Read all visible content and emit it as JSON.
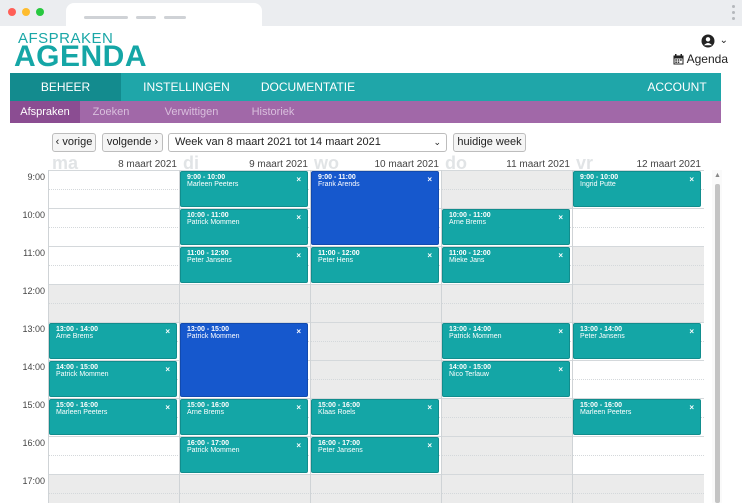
{
  "browser": {
    "title": ""
  },
  "logo": {
    "top": "AFSPRAKEN",
    "main": "AGENDA"
  },
  "user": {
    "icon": "user-icon",
    "agenda_label": "Agenda"
  },
  "nav": [
    {
      "label": "BEHEER",
      "active": true
    },
    {
      "label": "INSTELLINGEN",
      "active": false
    },
    {
      "label": "DOCUMENTATIE",
      "active": false
    },
    {
      "label": "ACCOUNT",
      "active": false
    }
  ],
  "subnav": [
    {
      "label": "Afspraken",
      "active": true
    },
    {
      "label": "Zoeken",
      "active": false
    },
    {
      "label": "Verwittigen",
      "active": false
    },
    {
      "label": "Historiek",
      "active": false
    }
  ],
  "toolbar": {
    "prev": "‹ vorige",
    "next": "volgende ›",
    "week_select": "Week van 8 maart 2021 tot 14 maart 2021",
    "today": "huidige week"
  },
  "days": [
    {
      "abbr": "ma",
      "date": "8 maart 2021"
    },
    {
      "abbr": "di",
      "date": "9 maart 2021"
    },
    {
      "abbr": "wo",
      "date": "10 maart 2021"
    },
    {
      "abbr": "do",
      "date": "11 maart 2021"
    },
    {
      "abbr": "vr",
      "date": "12 maart 2021"
    }
  ],
  "hours": [
    "9:00",
    "10:00",
    "11:00",
    "12:00",
    "13:00",
    "14:00",
    "15:00",
    "16:00",
    "17:00"
  ],
  "events": [
    {
      "day": 0,
      "start": 13,
      "end": 14,
      "time": "13:00 - 14:00",
      "name": "Arne Brems",
      "color": "teal"
    },
    {
      "day": 0,
      "start": 14,
      "end": 15,
      "time": "14:00 - 15:00",
      "name": "Patrick Mommen",
      "color": "teal"
    },
    {
      "day": 0,
      "start": 15,
      "end": 16,
      "time": "15:00 - 16:00",
      "name": "Marleen Peeters",
      "color": "teal"
    },
    {
      "day": 1,
      "start": 9,
      "end": 10,
      "time": "9:00 - 10:00",
      "name": "Marleen Peeters",
      "color": "teal"
    },
    {
      "day": 1,
      "start": 10,
      "end": 11,
      "time": "10:00 - 11:00",
      "name": "Patrick Mommen",
      "color": "teal"
    },
    {
      "day": 1,
      "start": 11,
      "end": 12,
      "time": "11:00 - 12:00",
      "name": "Peter Jansens",
      "color": "teal"
    },
    {
      "day": 1,
      "start": 13,
      "end": 15,
      "time": "13:00 - 15:00",
      "name": "Patrick Mommen",
      "color": "blue"
    },
    {
      "day": 1,
      "start": 15,
      "end": 16,
      "time": "15:00 - 16:00",
      "name": "Arne Brems",
      "color": "teal"
    },
    {
      "day": 1,
      "start": 16,
      "end": 17,
      "time": "16:00 - 17:00",
      "name": "Patrick Mommen",
      "color": "teal"
    },
    {
      "day": 2,
      "start": 9,
      "end": 11,
      "time": "9:00 - 11:00",
      "name": "Frank Arends",
      "color": "blue"
    },
    {
      "day": 2,
      "start": 11,
      "end": 12,
      "time": "11:00 - 12:00",
      "name": "Peter Hens",
      "color": "teal"
    },
    {
      "day": 2,
      "start": 15,
      "end": 16,
      "time": "15:00 - 16:00",
      "name": "Klaas Roels",
      "color": "teal"
    },
    {
      "day": 2,
      "start": 16,
      "end": 17,
      "time": "16:00 - 17:00",
      "name": "Peter Jansens",
      "color": "teal"
    },
    {
      "day": 3,
      "start": 10,
      "end": 11,
      "time": "10:00 - 11:00",
      "name": "Arne Brems",
      "color": "teal"
    },
    {
      "day": 3,
      "start": 11,
      "end": 12,
      "time": "11:00 - 12:00",
      "name": "Mieke Jans",
      "color": "teal"
    },
    {
      "day": 3,
      "start": 13,
      "end": 14,
      "time": "13:00 - 14:00",
      "name": "Patrick Mommen",
      "color": "teal"
    },
    {
      "day": 3,
      "start": 14,
      "end": 15,
      "time": "14:00 - 15:00",
      "name": "Nico Terlauw",
      "color": "teal"
    },
    {
      "day": 4,
      "start": 9,
      "end": 10,
      "time": "9:00 - 10:00",
      "name": "Ingrid Putte",
      "color": "teal"
    },
    {
      "day": 4,
      "start": 13,
      "end": 14,
      "time": "13:00 - 14:00",
      "name": "Peter Jansens",
      "color": "teal"
    },
    {
      "day": 4,
      "start": 15,
      "end": 16,
      "time": "15:00 - 16:00",
      "name": "Marleen Peeters",
      "color": "teal"
    }
  ],
  "close_glyph": "×",
  "colors": {
    "teal": "#14a6a6",
    "blue": "#1658cd",
    "purple": "#a168a8",
    "nav": "#1fa6a9"
  }
}
